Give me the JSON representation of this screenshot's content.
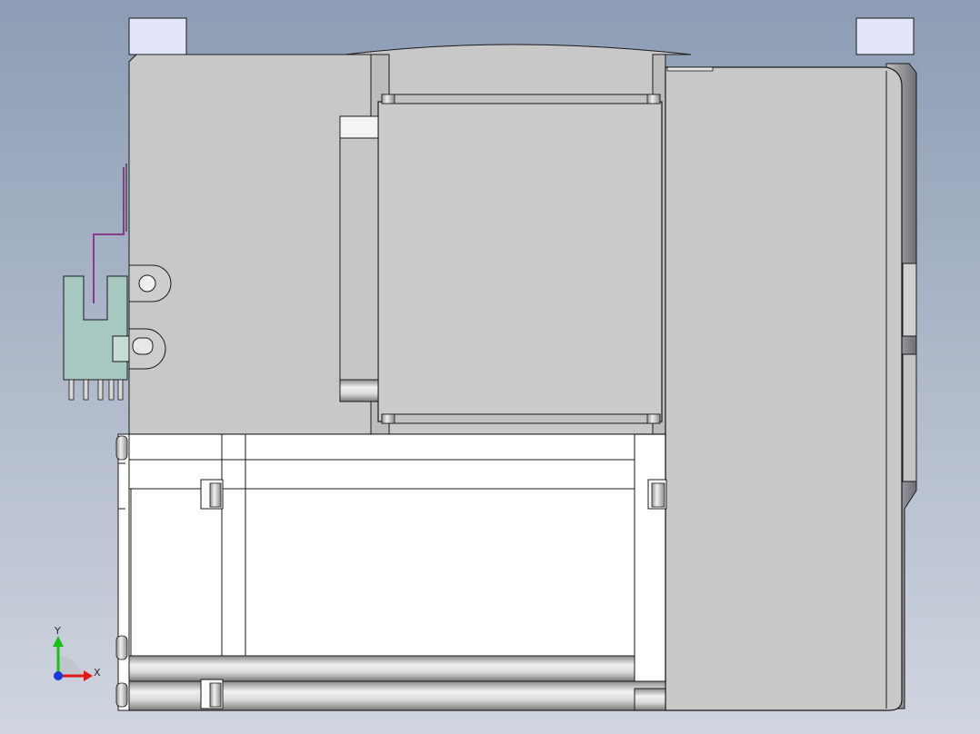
{
  "viewport": {
    "background_top": "#8d9db5",
    "background_bottom": "#d0d5df"
  },
  "model": {
    "body_fill": "#c8c8c8",
    "cover_fill": "#c9c9c9",
    "motor_fill": "#ffffff",
    "mount_pad_fill": "#e3e6fb",
    "sensor_fill": "#a6c8c0",
    "cable_color": "#8a3a8a",
    "edge_color": "#1a1a1a"
  },
  "triad": {
    "x_label": "X",
    "y_label": "Y",
    "x_color": "#e01818",
    "y_color": "#18c018",
    "z_color": "#1838e0"
  }
}
